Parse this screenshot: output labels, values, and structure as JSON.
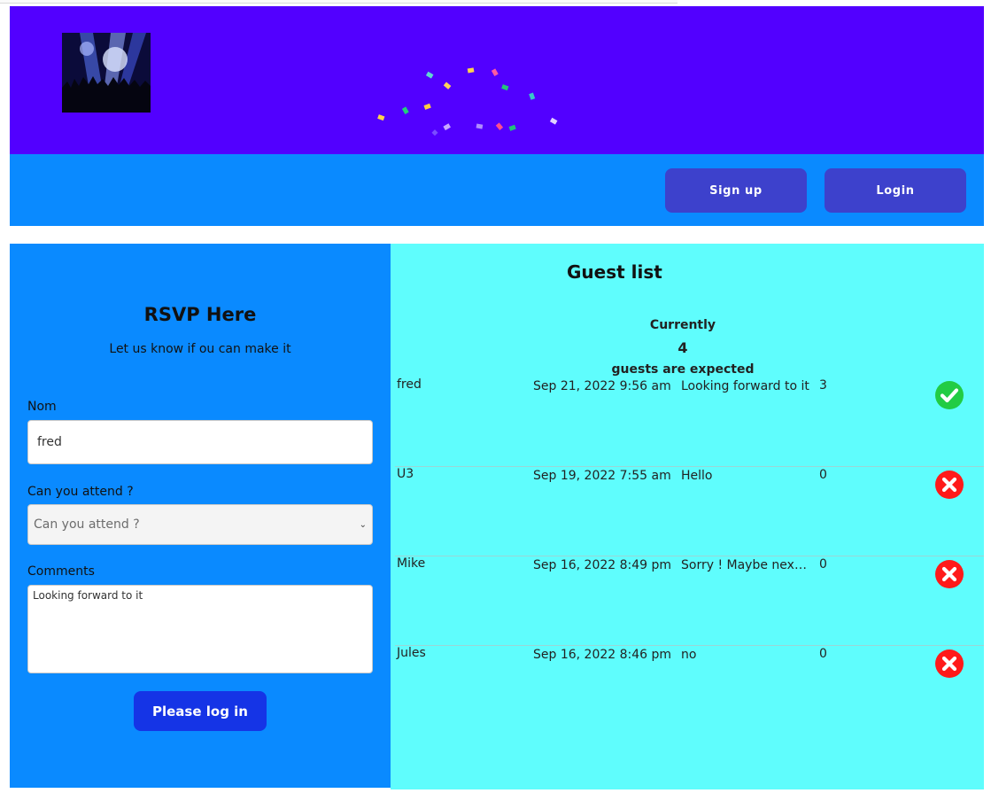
{
  "header": {
    "logo_alt": "concert crowd logo"
  },
  "nav": {
    "signup_label": "Sign up",
    "login_label": "Login"
  },
  "rsvp": {
    "title": "RSVP Here",
    "subtitle": "Let us know if ou can make it",
    "name_label": "Nom",
    "name_value": "fred",
    "attend_label": "Can you attend ?",
    "attend_placeholder": "Can you attend ?",
    "comments_label": "Comments",
    "comments_value": "Looking forward to it",
    "submit_label": "Please log in"
  },
  "guest_list": {
    "title": "Guest list",
    "currently_label": "Currently",
    "count": "4",
    "expected_label": "guests are expected",
    "rows": [
      {
        "name": "fred",
        "date": "Sep 21, 2022 9:56 am",
        "message": "Looking forward to it",
        "number": "3",
        "status": "attending"
      },
      {
        "name": "U3",
        "date": "Sep 19, 2022 7:55 am",
        "message": "Hello",
        "number": "0",
        "status": "not-attending"
      },
      {
        "name": "Mike",
        "date": "Sep 16, 2022 8:49 pm",
        "message": "Sorry ! Maybe next time",
        "number": "0",
        "status": "not-attending"
      },
      {
        "name": "Jules",
        "date": "Sep 16, 2022 8:46 pm",
        "message": "no",
        "number": "0",
        "status": "not-attending"
      }
    ]
  },
  "colors": {
    "banner": "#5200ff",
    "nav": "#0a8aff",
    "nav_button": "#3d41cc",
    "guest_panel": "#5ffdfd",
    "login_button": "#1534e6",
    "check": "#22cc44",
    "cross": "#ff1a1a"
  }
}
